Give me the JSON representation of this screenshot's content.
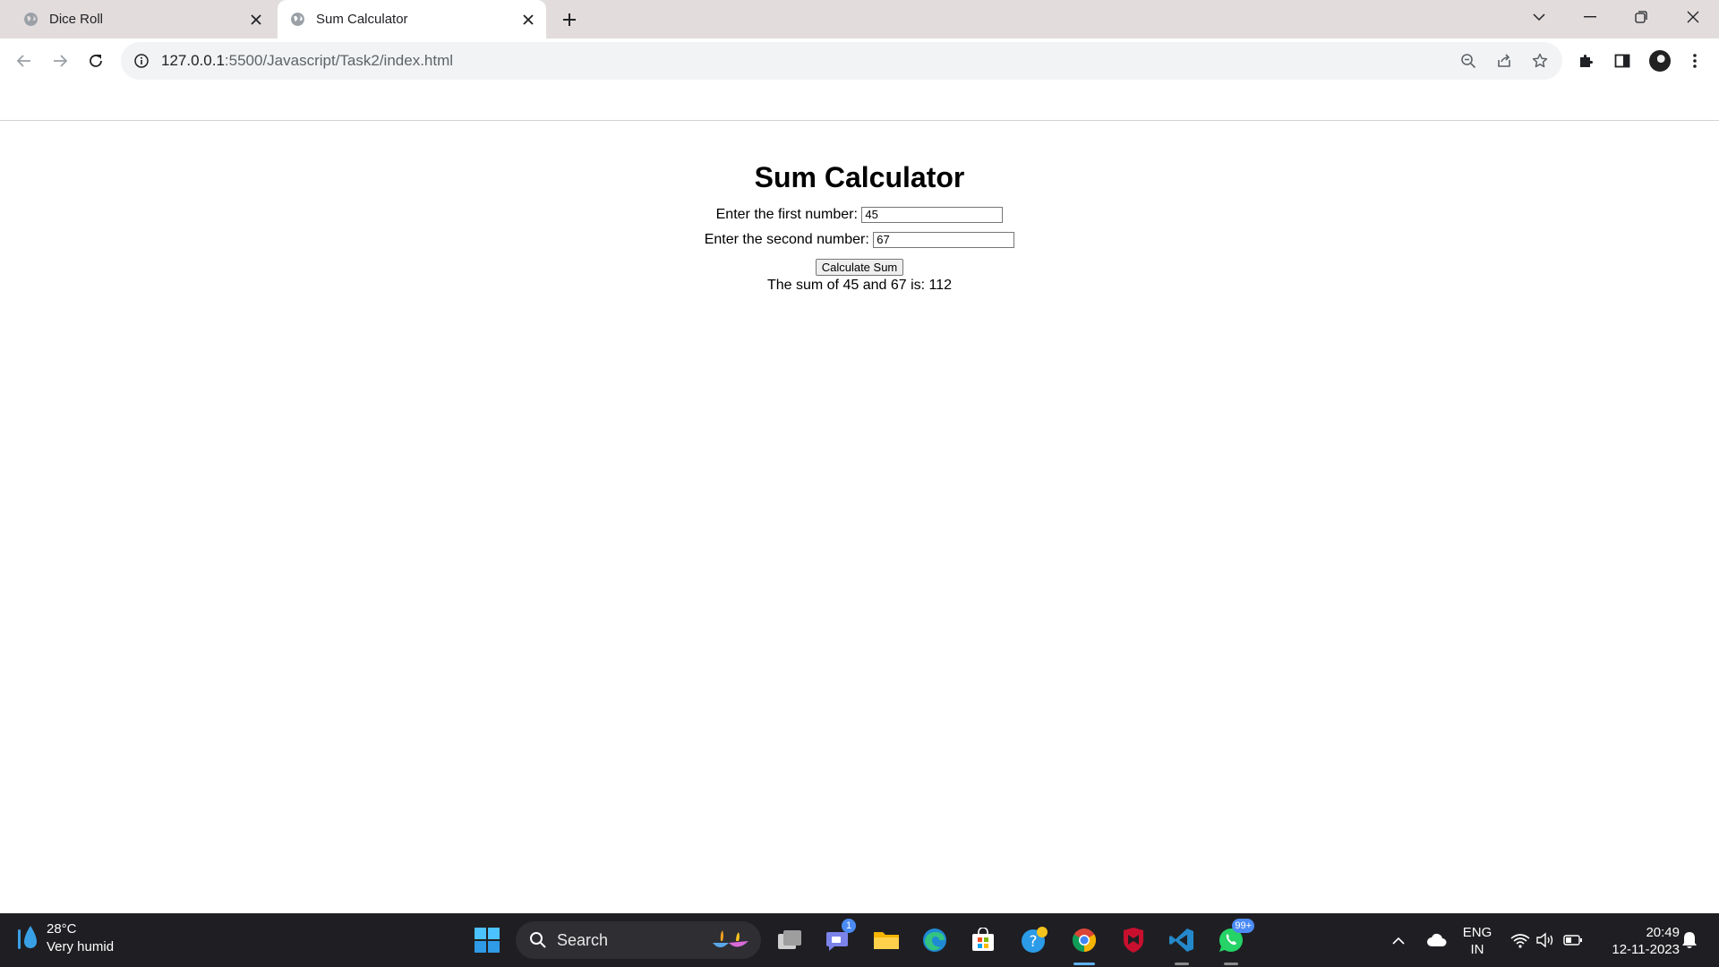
{
  "browser": {
    "tabs": [
      {
        "title": "Dice Roll",
        "active": false
      },
      {
        "title": "Sum Calculator",
        "active": true
      }
    ],
    "url": {
      "host": "127.0.0.1",
      "rest": ":5500/Javascript/Task2/index.html"
    }
  },
  "page": {
    "title": "Sum Calculator",
    "first_label": "Enter the first number:",
    "first_value": "45",
    "second_label": "Enter the second number:",
    "second_value": "67",
    "button_label": "Calculate Sum",
    "result": "The sum of 45 and 67 is: 112"
  },
  "taskbar": {
    "weather": {
      "temp": "28°C",
      "desc": "Very humid"
    },
    "search_label": "Search",
    "teams_badge": "1",
    "whatsapp_badge": "99+",
    "lang": {
      "line1": "ENG",
      "line2": "IN"
    },
    "clock": {
      "time": "20:49",
      "date": "12-11-2023"
    }
  },
  "colors": {
    "tabstrip": "#e2dcdd",
    "taskbar": "#1f1f23",
    "accent": "#5fb2f2"
  }
}
